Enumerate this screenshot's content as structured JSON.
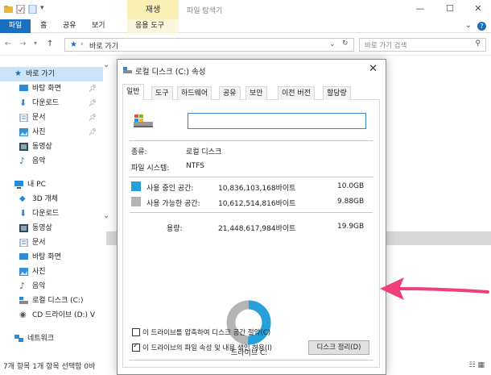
{
  "titlebar": {
    "context_tab": "재생",
    "title": "파일 탐색기",
    "minimize": "—",
    "maximize": "☐",
    "close": "✕"
  },
  "ribbon": {
    "tabs": [
      "파일",
      "홈",
      "공유",
      "보기",
      "응용 도구"
    ],
    "expand": "⌄"
  },
  "address": {
    "back": "←",
    "forward": "→",
    "up": "↑",
    "path": "바로 가기",
    "search_placeholder": "바로 가기 검색"
  },
  "sidebar": {
    "quick_access": "바로 가기",
    "items": [
      {
        "label": "바탕 화면",
        "icon": "desktop-icon",
        "pinned": true
      },
      {
        "label": "다운로드",
        "icon": "download-icon",
        "pinned": true
      },
      {
        "label": "문서",
        "icon": "document-icon",
        "pinned": true
      },
      {
        "label": "사진",
        "icon": "picture-icon",
        "pinned": true
      },
      {
        "label": "동영상",
        "icon": "video-icon",
        "pinned": false
      },
      {
        "label": "음악",
        "icon": "music-icon",
        "pinned": false
      }
    ],
    "this_pc": "내 PC",
    "pc_items": [
      {
        "label": "3D 개체",
        "icon": "3d-icon"
      },
      {
        "label": "다운로드",
        "icon": "download-icon"
      },
      {
        "label": "동영상",
        "icon": "video-icon"
      },
      {
        "label": "문서",
        "icon": "document-icon"
      },
      {
        "label": "바탕 화면",
        "icon": "desktop-icon"
      },
      {
        "label": "사진",
        "icon": "picture-icon"
      },
      {
        "label": "음악",
        "icon": "music-icon"
      },
      {
        "label": "로컬 디스크 (C:)",
        "icon": "drive-icon"
      },
      {
        "label": "CD 드라이브 (D:) V",
        "icon": "cd-icon"
      }
    ],
    "network": "네트워크"
  },
  "status": {
    "text": "7개 항목    1개 항목 선택함 0바"
  },
  "dialog": {
    "title": "로컬 디스크 (C:) 속성",
    "close": "✕",
    "tabs": [
      "일반",
      "도구",
      "하드웨어",
      "공유",
      "보안",
      "이전 버전",
      "할당량"
    ],
    "name_value": "",
    "type_label": "종류:",
    "type_value": "로컬 디스크",
    "fs_label": "파일 시스템:",
    "fs_value": "NTFS",
    "used_label": "사용 중인 공간:",
    "used_bytes": "10,836,103,168바이트",
    "used_gb": "10.0GB",
    "free_label": "사용 가능한 공간:",
    "free_bytes": "10,612,514,816바이트",
    "free_gb": "9.88GB",
    "capacity_label": "용량:",
    "capacity_bytes": "21,448,617,984바이트",
    "capacity_gb": "19.9GB",
    "drive_label": "드라이브 C:",
    "cleanup_button": "디스크 정리(D)",
    "compress_label": "이 드라이브를 압축하여 디스크 공간 절약(C)",
    "compress_checked": false,
    "index_label": "이 드라이브의 파일 속성 및 내용 색인 허용(I)",
    "index_checked": true,
    "used_fraction": 0.505
  },
  "colors": {
    "accent": "#1a6fc1",
    "used": "#26a0da",
    "free": "#b4b4b4",
    "context_tab": "#f7efb4",
    "arrow": "#f0407a"
  }
}
